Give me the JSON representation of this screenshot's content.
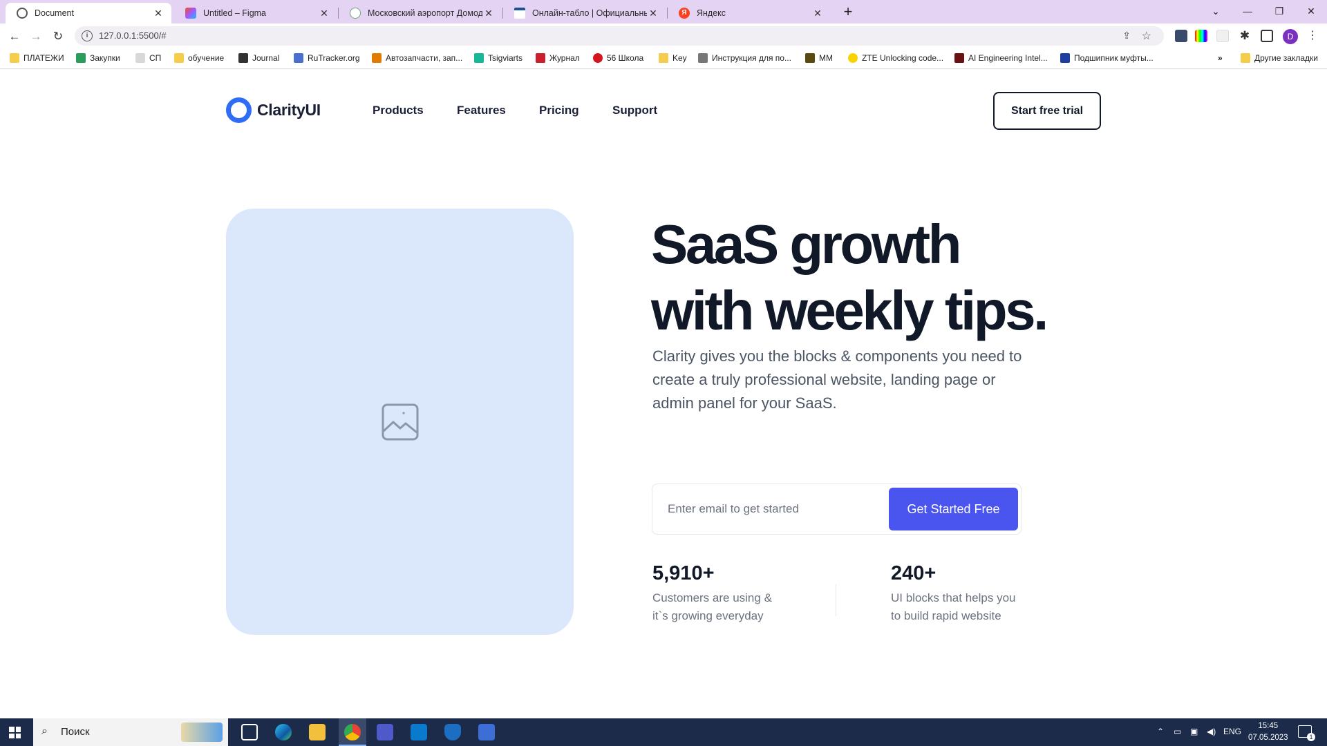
{
  "browser": {
    "tabs": [
      {
        "title": "Document",
        "active": true
      },
      {
        "title": "Untitled – Figma",
        "active": false
      },
      {
        "title": "Московский аэропорт Домодедово",
        "active": false
      },
      {
        "title": "Онлайн-табло | Официальный сайт",
        "active": false
      },
      {
        "title": "Яндекс",
        "active": false
      }
    ],
    "url": "127.0.0.1:5500/#",
    "profile_initial": "D",
    "bookmarks": [
      "ПЛАТЕЖИ",
      "Закупки",
      "СП",
      "обучение",
      "Journal",
      "RuTracker.org",
      "Автозапчасти, зап...",
      "Tsigviarts",
      "Журнал",
      "56 Школа",
      "Key",
      "Инструкция для по...",
      "MM",
      "ZTE Unlocking code...",
      "AI Engineering Intel...",
      "Подшипник муфты..."
    ],
    "bookmarks_overflow": "»",
    "other_bookmarks": "Другие закладки"
  },
  "site": {
    "brand": "ClarityUI",
    "nav": [
      "Products",
      "Features",
      "Pricing",
      "Support"
    ],
    "cta_outline": "Start free trial",
    "hero": {
      "headline_line1": "SaaS growth",
      "headline_line2": "with weekly tips.",
      "subtext": "Clarity gives you the blocks & components you need to create a truly professional website, landing page or admin panel for your SaaS.",
      "email_placeholder": "Enter email to get started",
      "cta_primary": "Get Started Free"
    },
    "stats": [
      {
        "value": "5,910+",
        "label": "Customers are using & it`s growing everyday"
      },
      {
        "value": "240+",
        "label": "UI blocks that helps you to build rapid website"
      }
    ]
  },
  "taskbar": {
    "search_placeholder": "Поиск",
    "language": "ENG",
    "time": "15:45",
    "date": "07.05.2023",
    "notification_count": "1"
  },
  "colors": {
    "accent": "#4a55f0",
    "brand_blue": "#2f6df6",
    "image_placeholder": "#dbe8fc",
    "tabstrip": "#e5d3f3",
    "taskbar": "#1c2b4a"
  }
}
